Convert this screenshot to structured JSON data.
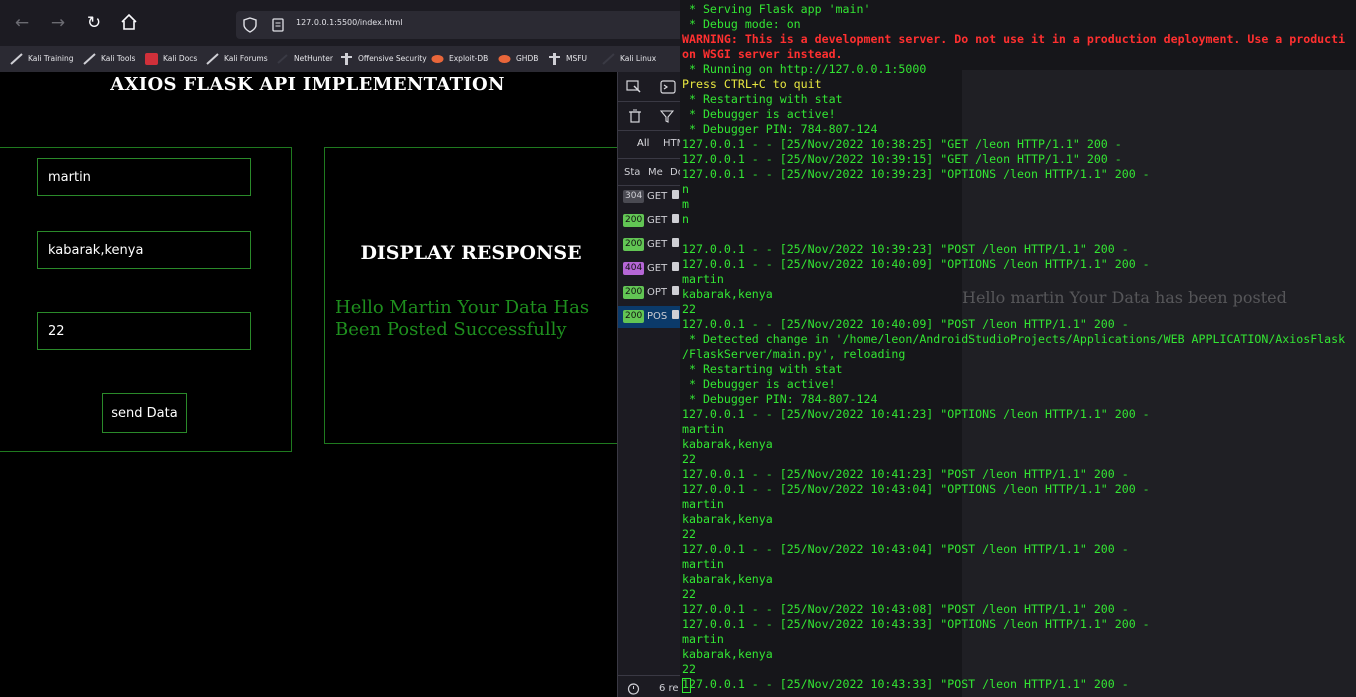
{
  "browser": {
    "url": "127.0.0.1:5500/index.html",
    "bookmarks": [
      "Kali Training",
      "Kali Tools",
      "Kali Docs",
      "Kali Forums",
      "NetHunter",
      "Offensive Security",
      "Exploit-DB",
      "GHDB",
      "MSFU",
      "Kali Linux"
    ]
  },
  "page": {
    "title": "AXIOS FLASK API IMPLEMENTATION",
    "fields": {
      "name": "martin",
      "location": "kabarak,kenya",
      "age": "22"
    },
    "send_label": "send Data",
    "response_heading": "DISPLAY RESPONSE",
    "response_text": "Hello Martin Your Data Has Been Posted Successfully"
  },
  "devtools": {
    "filters": [
      "All",
      "HTM"
    ],
    "col_headers": [
      "Sta",
      "Me",
      "Do"
    ],
    "requests": [
      {
        "status": "304",
        "method": "GET",
        "color": "#4a4a52"
      },
      {
        "status": "200",
        "method": "GET",
        "color": "#62c554"
      },
      {
        "status": "200",
        "method": "GET",
        "color": "#62c554"
      },
      {
        "status": "404",
        "method": "GET",
        "color": "#b566d6"
      },
      {
        "status": "200",
        "method": "OPT",
        "color": "#62c554"
      },
      {
        "status": "200",
        "method": "POS",
        "color": "#62c554"
      }
    ],
    "footer": "6 re"
  },
  "terminal": {
    "ghost_text": "Hello martin Your Data has been posted",
    "lines": [
      {
        "t": " * Serving Flask app 'main'",
        "c": "green"
      },
      {
        "t": " * Debug mode: on",
        "c": "green"
      },
      {
        "t": "WARNING: This is a development server. Do not use it in a production deployment. Use a producti",
        "c": "red"
      },
      {
        "t": "on WSGI server instead.",
        "c": "red"
      },
      {
        "t": " * Running on http://127.0.0.1:5000",
        "c": "green"
      },
      {
        "t": "Press CTRL+C to quit",
        "c": "yellow"
      },
      {
        "t": " * Restarting with stat",
        "c": "green"
      },
      {
        "t": " * Debugger is active!",
        "c": "green"
      },
      {
        "t": " * Debugger PIN: 784-807-124",
        "c": "green"
      },
      {
        "t": "127.0.0.1 - - [25/Nov/2022 10:38:25] \"GET /leon HTTP/1.1\" 200 -",
        "c": "green"
      },
      {
        "t": "127.0.0.1 - - [25/Nov/2022 10:39:15] \"GET /leon HTTP/1.1\" 200 -",
        "c": "green"
      },
      {
        "t": "127.0.0.1 - - [25/Nov/2022 10:39:23] \"OPTIONS /leon HTTP/1.1\" 200 -",
        "c": "green"
      },
      {
        "t": "n",
        "c": "green"
      },
      {
        "t": "m",
        "c": "green"
      },
      {
        "t": "n",
        "c": "green"
      },
      {
        "t": "",
        "c": "green"
      },
      {
        "t": "127.0.0.1 - - [25/Nov/2022 10:39:23] \"POST /leon HTTP/1.1\" 200 -",
        "c": "green"
      },
      {
        "t": "127.0.0.1 - - [25/Nov/2022 10:40:09] \"OPTIONS /leon HTTP/1.1\" 200 -",
        "c": "green"
      },
      {
        "t": "martin",
        "c": "green"
      },
      {
        "t": "kabarak,kenya",
        "c": "green"
      },
      {
        "t": "22",
        "c": "green"
      },
      {
        "t": "127.0.0.1 - - [25/Nov/2022 10:40:09] \"POST /leon HTTP/1.1\" 200 -",
        "c": "green"
      },
      {
        "t": " * Detected change in '/home/leon/AndroidStudioProjects/Applications/WEB APPLICATION/AxiosFlask",
        "c": "green"
      },
      {
        "t": "/FlaskServer/main.py', reloading",
        "c": "green"
      },
      {
        "t": " * Restarting with stat",
        "c": "green"
      },
      {
        "t": " * Debugger is active!",
        "c": "green"
      },
      {
        "t": " * Debugger PIN: 784-807-124",
        "c": "green"
      },
      {
        "t": "127.0.0.1 - - [25/Nov/2022 10:41:23] \"OPTIONS /leon HTTP/1.1\" 200 -",
        "c": "green"
      },
      {
        "t": "martin",
        "c": "green"
      },
      {
        "t": "kabarak,kenya",
        "c": "green"
      },
      {
        "t": "22",
        "c": "green"
      },
      {
        "t": "127.0.0.1 - - [25/Nov/2022 10:41:23] \"POST /leon HTTP/1.1\" 200 -",
        "c": "green"
      },
      {
        "t": "127.0.0.1 - - [25/Nov/2022 10:43:04] \"OPTIONS /leon HTTP/1.1\" 200 -",
        "c": "green"
      },
      {
        "t": "martin",
        "c": "green"
      },
      {
        "t": "kabarak,kenya",
        "c": "green"
      },
      {
        "t": "22",
        "c": "green"
      },
      {
        "t": "127.0.0.1 - - [25/Nov/2022 10:43:04] \"POST /leon HTTP/1.1\" 200 -",
        "c": "green"
      },
      {
        "t": "martin",
        "c": "green"
      },
      {
        "t": "kabarak,kenya",
        "c": "green"
      },
      {
        "t": "22",
        "c": "green"
      },
      {
        "t": "127.0.0.1 - - [25/Nov/2022 10:43:08] \"POST /leon HTTP/1.1\" 200 -",
        "c": "green"
      },
      {
        "t": "127.0.0.1 - - [25/Nov/2022 10:43:33] \"OPTIONS /leon HTTP/1.1\" 200 -",
        "c": "green"
      },
      {
        "t": "martin",
        "c": "green"
      },
      {
        "t": "kabarak,kenya",
        "c": "green"
      },
      {
        "t": "22",
        "c": "green"
      },
      {
        "t": "127.0.0.1 - - [25/Nov/2022 10:43:33] \"POST /leon HTTP/1.1\" 200 -",
        "c": "green"
      }
    ]
  }
}
